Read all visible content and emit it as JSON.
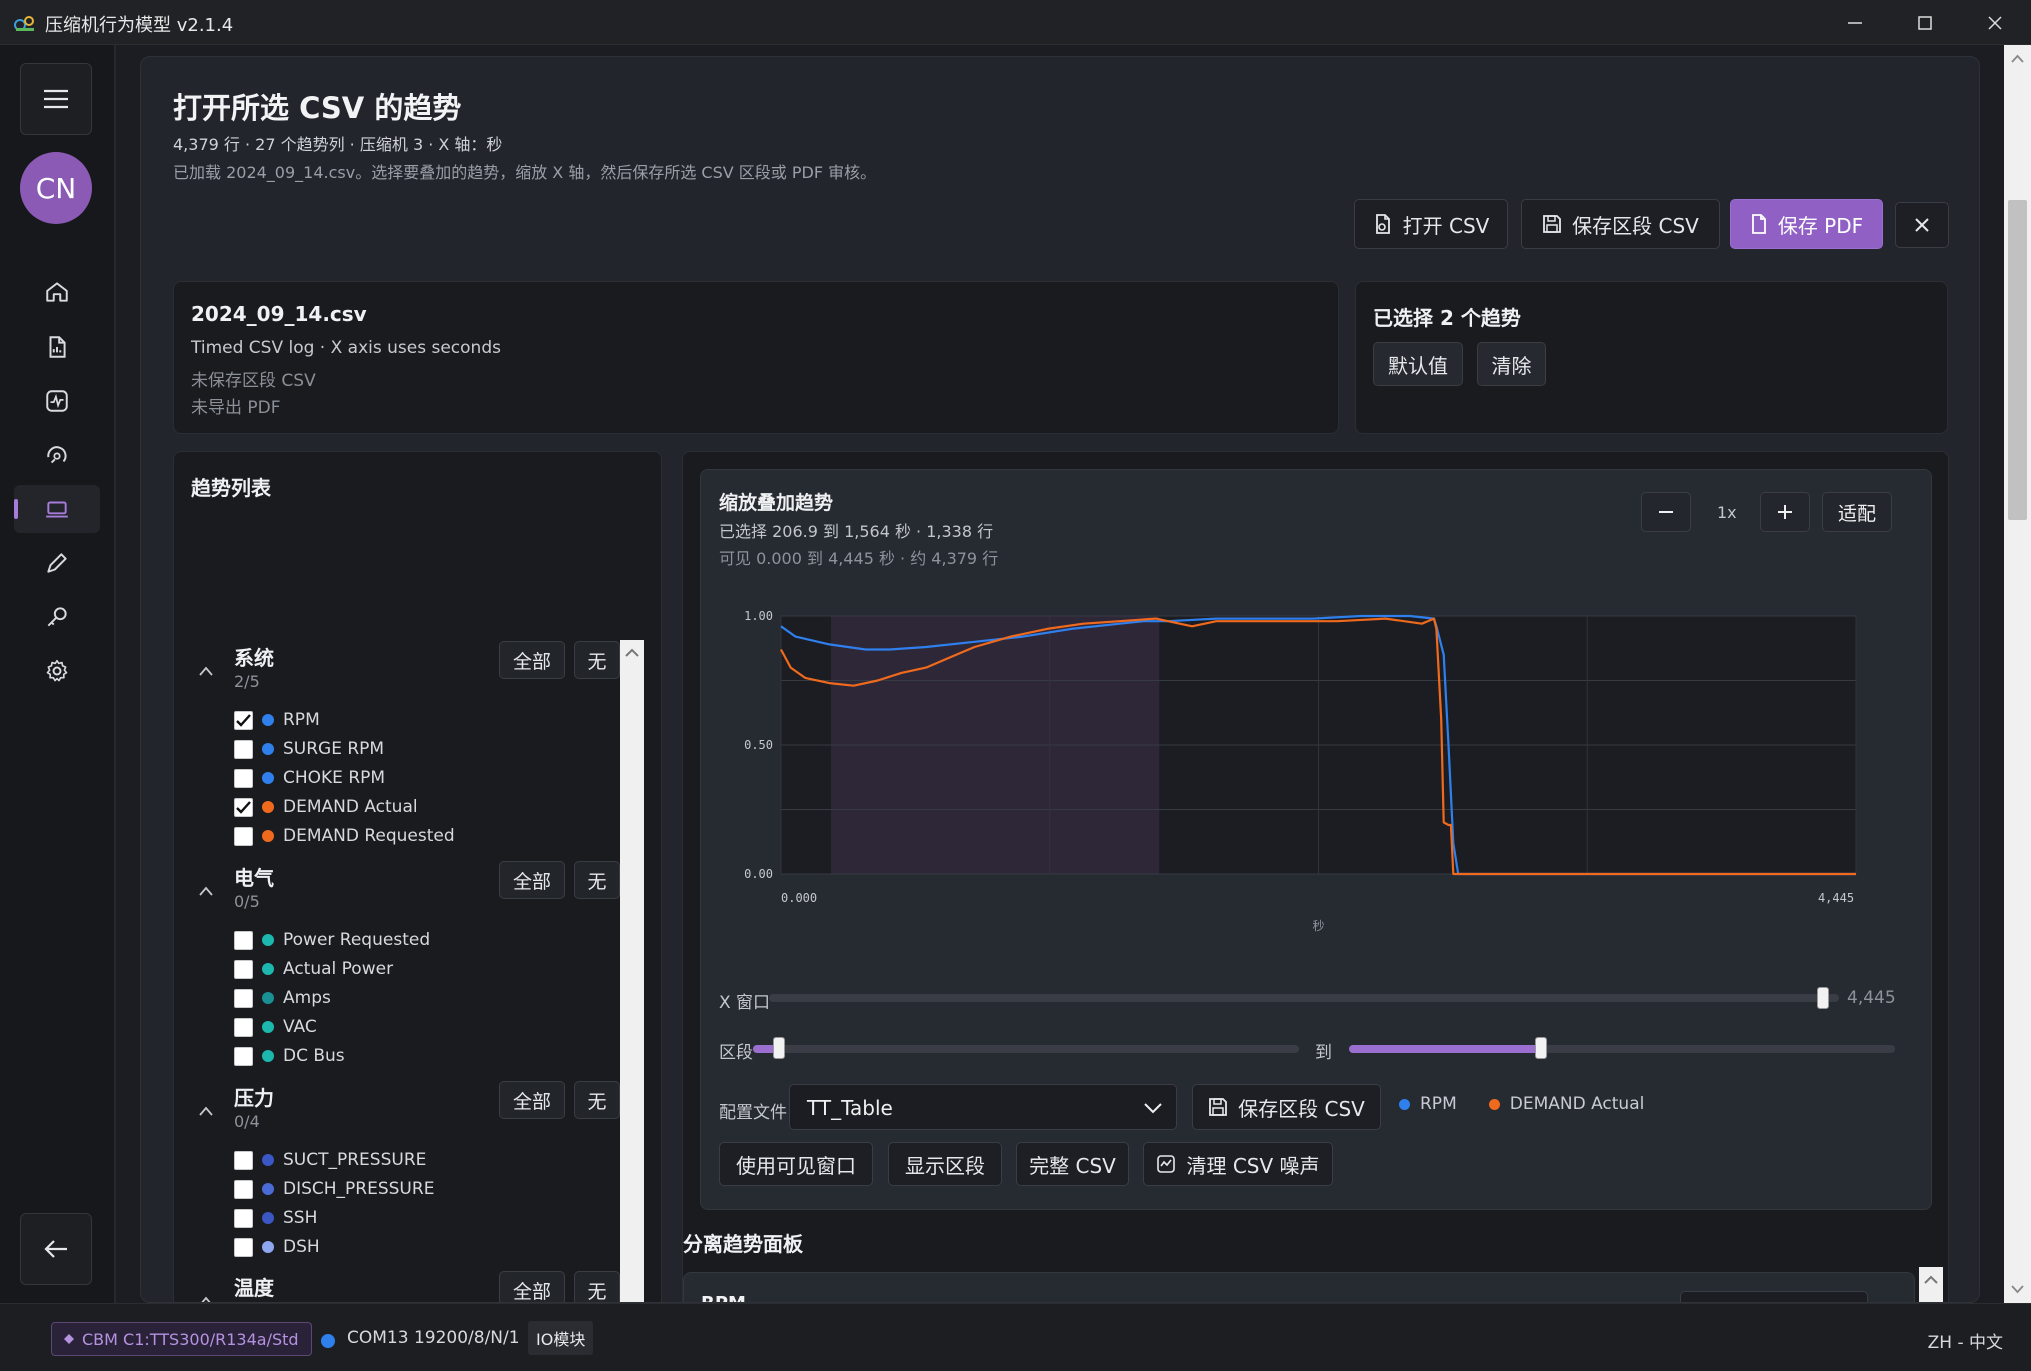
{
  "window": {
    "title": "压缩机行为模型 v2.1.4"
  },
  "page": {
    "title": "打开所选 CSV 的趋势",
    "meta": "4,379 行 · 27 个趋势列 · 压缩机 3 · X 轴：秒",
    "description": "已加载 2024_09_14.csv。选择要叠加的趋势，缩放 X 轴，然后保存所选 CSV 区段或 PDF 审核。"
  },
  "user": {
    "initials": "CN"
  },
  "toolbar": {
    "open_csv": "打开 CSV",
    "save_segment_csv": "保存区段 CSV",
    "save_pdf": "保存 PDF"
  },
  "file_info": {
    "name": "2024_09_14.csv",
    "type_line": "Timed CSV log · X axis uses seconds",
    "segment_status": "未保存区段 CSV",
    "pdf_status": "未导出 PDF"
  },
  "selection": {
    "title": "已选择 2 个趋势",
    "default_btn": "默认值",
    "clear_btn": "清除"
  },
  "trend_list": {
    "title": "趋势列表",
    "all_label": "全部",
    "none_label": "无",
    "groups": [
      {
        "name": "系统",
        "count": "2/5",
        "items": [
          {
            "label": "RPM",
            "checked": true,
            "color": "#2f80ed"
          },
          {
            "label": "SURGE RPM",
            "checked": false,
            "color": "#2f80ed"
          },
          {
            "label": "CHOKE RPM",
            "checked": false,
            "color": "#2f80ed"
          },
          {
            "label": "DEMAND Actual",
            "checked": true,
            "color": "#f06a1d"
          },
          {
            "label": "DEMAND Requested",
            "checked": false,
            "color": "#f06a1d"
          }
        ]
      },
      {
        "name": "电气",
        "count": "0/5",
        "items": [
          {
            "label": "Power Requested",
            "checked": false,
            "color": "#1cb8b0"
          },
          {
            "label": "Actual Power",
            "checked": false,
            "color": "#1cb8b0"
          },
          {
            "label": "Amps",
            "checked": false,
            "color": "#1a8f94"
          },
          {
            "label": "VAC",
            "checked": false,
            "color": "#1cb8b0"
          },
          {
            "label": "DC Bus",
            "checked": false,
            "color": "#1cb8b0"
          }
        ]
      },
      {
        "name": "压力",
        "count": "0/4",
        "items": [
          {
            "label": "SUCT_PRESSURE",
            "checked": false,
            "color": "#3b57c4"
          },
          {
            "label": "DISCH_PRESSURE",
            "checked": false,
            "color": "#4a6bd6"
          },
          {
            "label": "SSH",
            "checked": false,
            "color": "#3b57c4"
          },
          {
            "label": "DSH",
            "checked": false,
            "color": "#8fa7ef"
          }
        ]
      },
      {
        "name": "温度",
        "count": "",
        "items": []
      }
    ]
  },
  "chart_panel": {
    "title": "缩放叠加趋势",
    "selected_range": "已选择 206.9 到 1,564 秒 · 1,338 行",
    "visible_range": "可见 0.000 到 4,445 秒 · 约 4,379 行",
    "zoom_level": "1x",
    "fit_label": "适配",
    "x_window_label": "X 窗口",
    "x_window_value": "4,445",
    "segment_label": "区段",
    "to_label": "到",
    "profile_label": "配置文件",
    "profile_value": "TT_Table",
    "save_segment_csv": "保存区段 CSV",
    "use_visible_window": "使用可见窗口",
    "show_segment": "显示区段",
    "full_csv": "完整 CSV",
    "clean_csv_noise": "清理 CSV 噪声",
    "x_window_fraction": 0.985,
    "segment_start_fraction": 0.047,
    "segment_end_fraction": 0.352
  },
  "separate_panel": {
    "title": "分离趋势面板",
    "first_item": "RPM"
  },
  "status_bar": {
    "device": "CBM C1:TTS300/R134a/Std",
    "port": "COM13 19200/8/N/1",
    "module": "IO模块",
    "language": "ZH - 中文"
  },
  "chart_data": {
    "type": "line",
    "title": "",
    "xlabel": "秒",
    "ylabel": "",
    "xlim": [
      0,
      4445
    ],
    "ylim": [
      0,
      1
    ],
    "x_tick_labels": [
      "0.000",
      "4,445"
    ],
    "y_tick_labels": [
      "0.00",
      "0.50",
      "1.00"
    ],
    "grid": true,
    "legend": "right of profile selector",
    "highlight_segment": [
      206.9,
      1564
    ],
    "series": [
      {
        "name": "RPM",
        "color": "#2f80ed",
        "x": [
          0,
          60,
          200,
          350,
          450,
          600,
          800,
          1000,
          1200,
          1400,
          1500,
          1600,
          1800,
          2000,
          2200,
          2400,
          2600,
          2700,
          2710,
          2740,
          2760,
          2780,
          2800,
          3200,
          3600,
          4000,
          4445
        ],
        "y": [
          0.96,
          0.92,
          0.89,
          0.87,
          0.87,
          0.88,
          0.9,
          0.92,
          0.95,
          0.97,
          0.98,
          0.98,
          0.99,
          0.99,
          0.99,
          1.0,
          1.0,
          0.99,
          0.96,
          0.85,
          0.5,
          0.12,
          0.0,
          0.0,
          0.0,
          0.0,
          0.0
        ]
      },
      {
        "name": "DEMAND Actual",
        "color": "#f06a1d",
        "x": [
          0,
          40,
          100,
          200,
          300,
          400,
          500,
          600,
          700,
          800,
          950,
          1100,
          1250,
          1400,
          1550,
          1700,
          1800,
          1950,
          2100,
          2300,
          2500,
          2650,
          2700,
          2710,
          2730,
          2740,
          2760,
          2770,
          2780,
          3200,
          3600,
          4000,
          4445
        ],
        "y": [
          0.87,
          0.8,
          0.76,
          0.74,
          0.73,
          0.75,
          0.78,
          0.8,
          0.84,
          0.88,
          0.92,
          0.95,
          0.97,
          0.98,
          0.99,
          0.96,
          0.98,
          0.98,
          0.98,
          0.98,
          0.99,
          0.97,
          0.99,
          0.95,
          0.6,
          0.2,
          0.19,
          0.19,
          0.0,
          0.0,
          0.0,
          0.0,
          0.0
        ]
      }
    ]
  }
}
